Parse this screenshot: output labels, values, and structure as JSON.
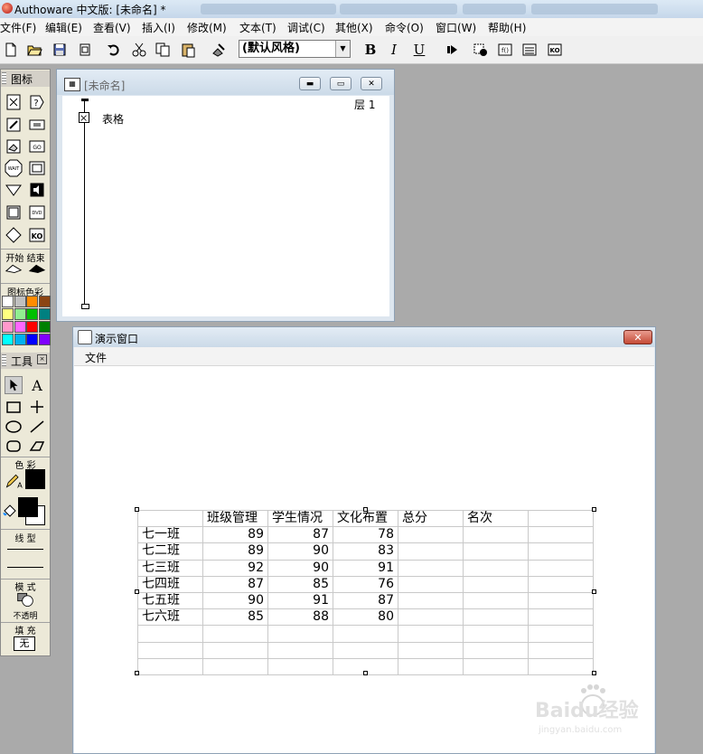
{
  "window": {
    "title": "Authoware 中文版: [未命名] *"
  },
  "menu": [
    "文件(F)",
    "编辑(E)",
    "查看(V)",
    "插入(I)",
    "修改(M)",
    "文本(T)",
    "调试(C)",
    "其他(X)",
    "命令(O)",
    "窗口(W)",
    "帮助(H)"
  ],
  "toolbar": {
    "style_value": "(默认风格)",
    "bold_label": "B",
    "italic_label": "I",
    "underline_label": "U"
  },
  "icon_palette": {
    "title": "图标",
    "start_label": "开始",
    "end_label": "结束",
    "color_label": "图标色彩",
    "icons": [
      "display-icon",
      "interaction-icon",
      "motion-icon",
      "calculation-icon",
      "erase-icon",
      "navigate-icon",
      "wait-icon",
      "movie-icon",
      "decision-icon",
      "sound-icon",
      "map-icon",
      "dvd-video-icon",
      "framework-icon",
      "knowledge-object-icon"
    ],
    "swatch_colors": [
      "#ffffff",
      "#c0c0c0",
      "#ff8c00",
      "#8b4513",
      "#ffff80",
      "#90ee90",
      "#00c000",
      "#008080",
      "#ff99cc",
      "#ff66ff",
      "#ff0000",
      "#008000",
      "#00ffff",
      "#00b0f0",
      "#0000ff",
      "#8000ff"
    ]
  },
  "tools_panel": {
    "title": "工具",
    "color_label": "色 彩",
    "line_label": "线 型",
    "mode_label": "模 式",
    "opaque_label": "不透明",
    "fill_label": "填 充",
    "fill_value": "无",
    "text_tool_label": "A"
  },
  "flowline_window": {
    "title": "[未命名]",
    "level_label": "层 1",
    "icon_label": "表格"
  },
  "presentation_window": {
    "title": "演示窗口",
    "menu_file": "文件",
    "table": {
      "headers": [
        "",
        "班级管理",
        "学生情况",
        "文化布置",
        "总分",
        "名次",
        ""
      ],
      "rows": [
        [
          "七一班",
          "89",
          "87",
          "78",
          "",
          "",
          ""
        ],
        [
          "七二班",
          "89",
          "90",
          "83",
          "",
          "",
          ""
        ],
        [
          "七三班",
          "92",
          "90",
          "91",
          "",
          "",
          ""
        ],
        [
          "七四班",
          "87",
          "85",
          "76",
          "",
          "",
          ""
        ],
        [
          "七五班",
          "90",
          "91",
          "87",
          "",
          "",
          ""
        ],
        [
          "七六班",
          "85",
          "88",
          "80",
          "",
          "",
          ""
        ],
        [
          "",
          "",
          "",
          "",
          "",
          "",
          ""
        ],
        [
          "",
          "",
          "",
          "",
          "",
          "",
          ""
        ],
        [
          "",
          "",
          "",
          "",
          "",
          "",
          ""
        ]
      ]
    }
  },
  "watermark": {
    "brand": "Baidu经验",
    "url": "jingyan.baidu.com"
  }
}
